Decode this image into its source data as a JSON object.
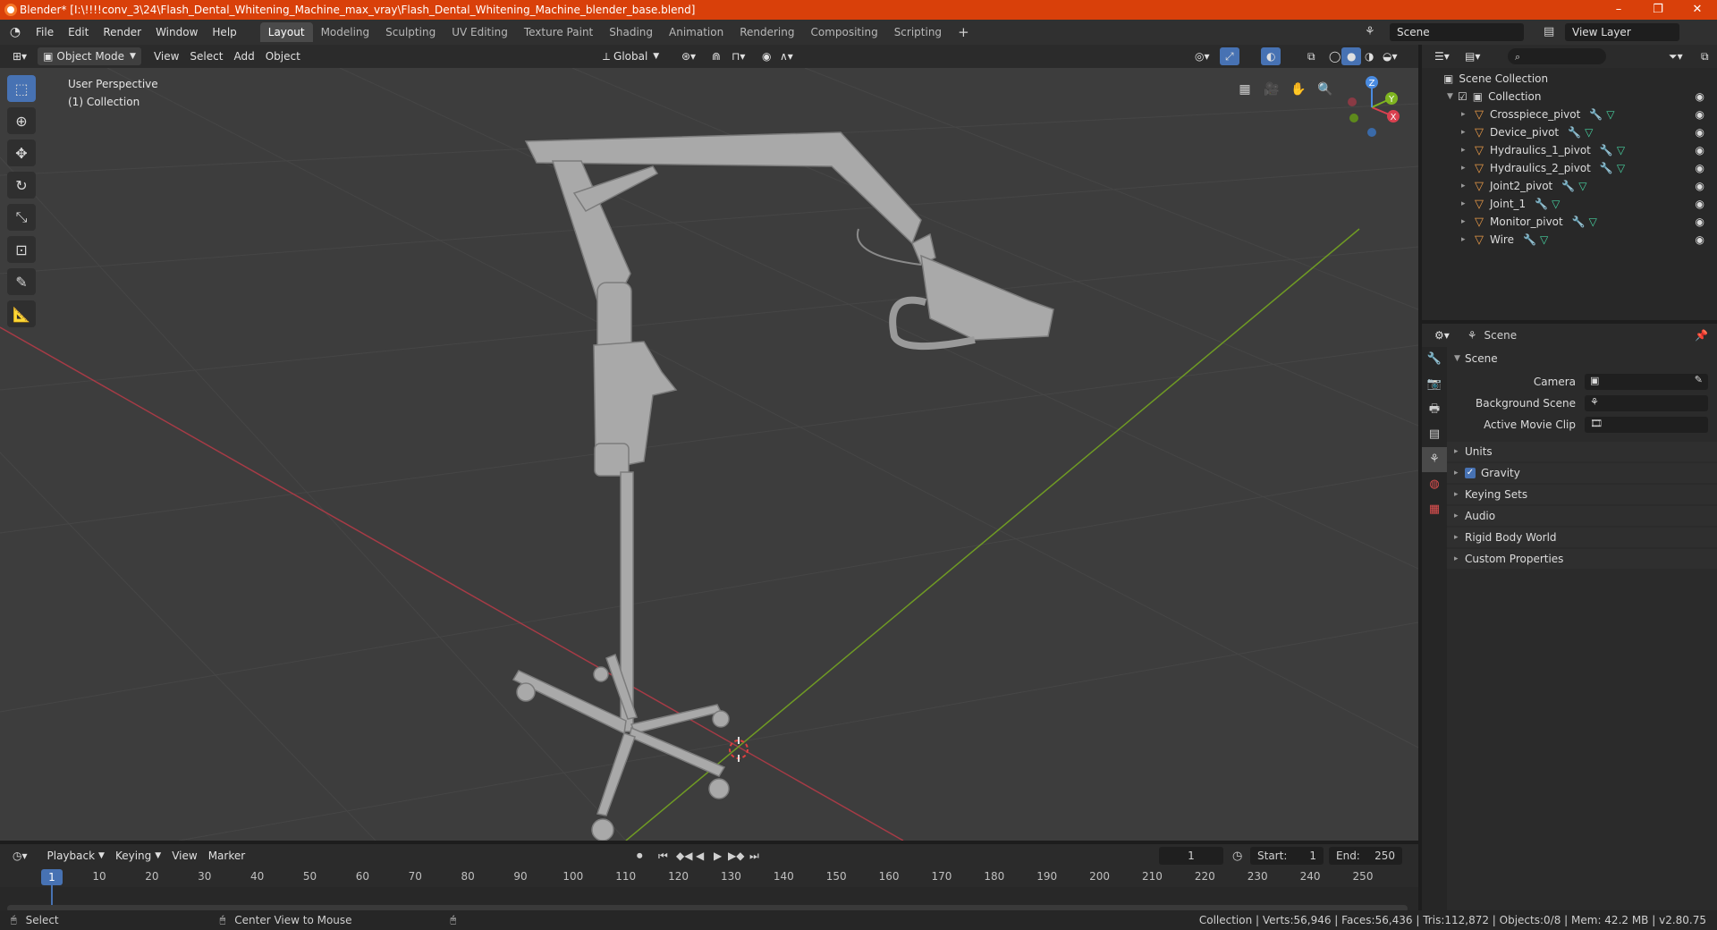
{
  "window": {
    "title": "Blender* [I:\\!!!!conv_3\\24\\Flash_Dental_Whitening_Machine_max_vray\\Flash_Dental_Whitening_Machine_blender_base.blend]",
    "controls": [
      "–",
      "❐",
      "✕"
    ]
  },
  "menu": [
    "File",
    "Edit",
    "Render",
    "Window",
    "Help"
  ],
  "workspaces": [
    "Layout",
    "Modeling",
    "Sculpting",
    "UV Editing",
    "Texture Paint",
    "Shading",
    "Animation",
    "Rendering",
    "Compositing",
    "Scripting"
  ],
  "active_workspace": "Layout",
  "scene_selector": "Scene",
  "view_layer_selector": "View Layer",
  "viewport_header": {
    "mode": "Object Mode",
    "menus": [
      "View",
      "Select",
      "Add",
      "Object"
    ],
    "transform_orientation": "Global"
  },
  "viewport": {
    "perspective": "User Perspective",
    "collection": "(1) Collection",
    "gizmo_axes": [
      "X",
      "Y",
      "Z"
    ]
  },
  "outliner": {
    "root": "Scene Collection",
    "collection": "Collection",
    "objects": [
      "Crosspiece_pivot",
      "Device_pivot",
      "Hydraulics_1_pivot",
      "Hydraulics_2_pivot",
      "Joint2_pivot",
      "Joint_1",
      "Monitor_pivot",
      "Wire"
    ]
  },
  "properties": {
    "context": "Scene",
    "panel": "Scene",
    "fields": [
      "Camera",
      "Background Scene",
      "Active Movie Clip"
    ],
    "subpanels": [
      "Units",
      "Gravity",
      "Keying Sets",
      "Audio",
      "Rigid Body World",
      "Custom Properties"
    ]
  },
  "timeline": {
    "menus": [
      "Playback",
      "Keying",
      "View",
      "Marker"
    ],
    "current_frame": "1",
    "start_label": "Start:",
    "start": "1",
    "end_label": "End:",
    "end": "250",
    "ticks": [
      "1",
      "10",
      "20",
      "30",
      "40",
      "50",
      "60",
      "70",
      "80",
      "90",
      "100",
      "110",
      "120",
      "130",
      "140",
      "150",
      "160",
      "170",
      "180",
      "190",
      "200",
      "210",
      "220",
      "230",
      "240",
      "250"
    ]
  },
  "statusbar": {
    "left": "Select",
    "middle": "Center View to Mouse",
    "stats": "Collection | Verts:56,946 | Faces:56,436 | Tris:112,872 | Objects:0/8 | Mem: 42.2 MB | v2.80.75"
  },
  "colors": {
    "titlebar": "#d9400a",
    "accent": "#4772b3",
    "x_axis": "#d9404f",
    "y_axis": "#7fb520",
    "object_icon": "#e99a48"
  }
}
